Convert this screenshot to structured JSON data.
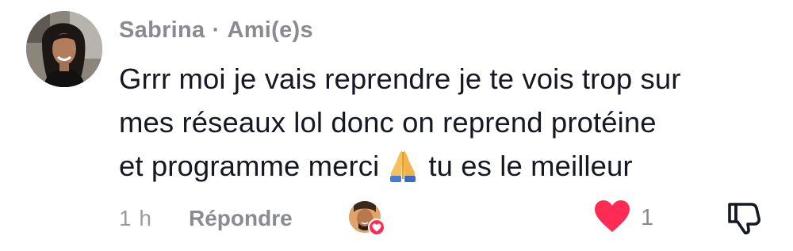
{
  "comment": {
    "author": "Sabrina",
    "separator": "·",
    "relation": "Ami(e)s",
    "text_lines": [
      "Grrr moi je vais reprendre je te vois trop sur",
      "mes réseaux lol donc on reprend protéine"
    ],
    "text_line3_before": "et programme merci",
    "text_emoji": "folded-hands-emoji",
    "text_line3_after": "tu es le meilleur",
    "time": "1 h",
    "reply_label": "Répondre",
    "like_count": "1",
    "colors": {
      "like_red": "#fe2c55",
      "meta_gray": "#8a8b91",
      "text": "#161823"
    },
    "icons": {
      "avatar": "user-avatar",
      "liked_by": "creator-liked-avatar",
      "like": "heart-icon",
      "dislike": "thumbs-down-icon"
    }
  }
}
